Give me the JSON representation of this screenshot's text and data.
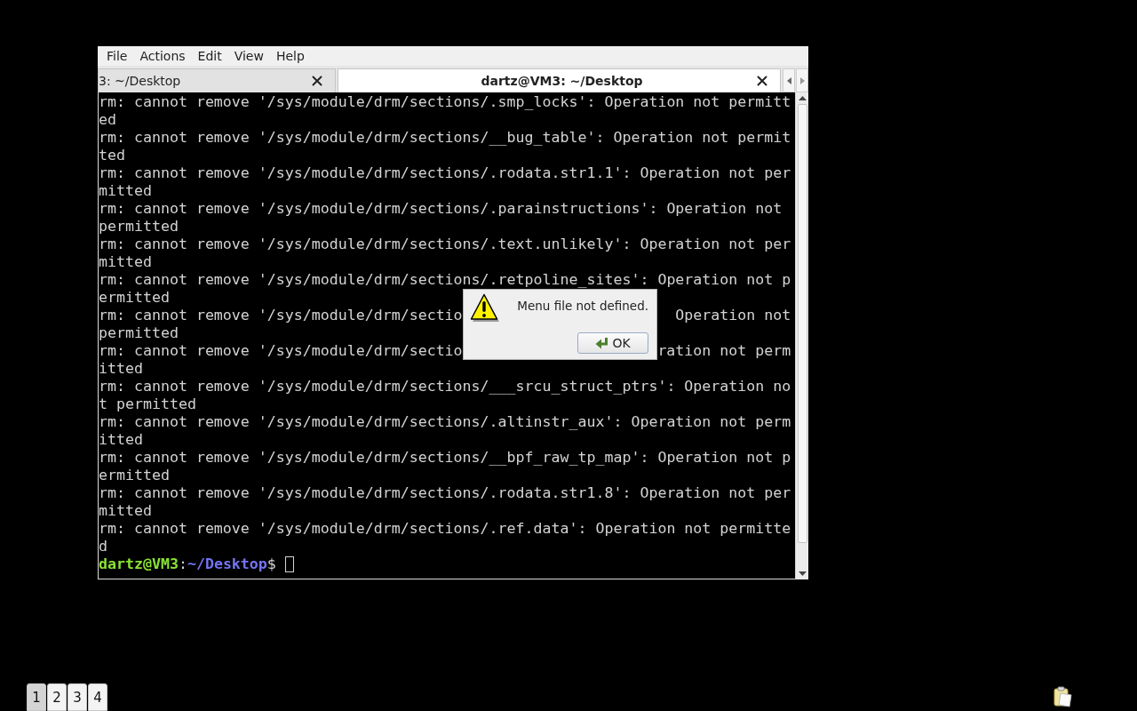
{
  "window": {
    "menu": [
      "File",
      "Actions",
      "Edit",
      "View",
      "Help"
    ],
    "tabs": [
      {
        "label": "3: ~/Desktop",
        "selected": false
      },
      {
        "label": "dartz@VM3: ~/Desktop",
        "selected": true
      }
    ],
    "terminal": {
      "lines": [
        {
          "kind": "output",
          "text": "rm: cannot remove '/sys/module/drm/sections/.smp_locks': Operation not permitt"
        },
        {
          "kind": "output",
          "text": "ed"
        },
        {
          "kind": "output",
          "text": "rm: cannot remove '/sys/module/drm/sections/__bug_table': Operation not permit"
        },
        {
          "kind": "output",
          "text": "ted"
        },
        {
          "kind": "output",
          "text": "rm: cannot remove '/sys/module/drm/sections/.rodata.str1.1': Operation not per"
        },
        {
          "kind": "output",
          "text": "mitted"
        },
        {
          "kind": "output",
          "text": "rm: cannot remove '/sys/module/drm/sections/.parainstructions': Operation not"
        },
        {
          "kind": "output",
          "text": "permitted"
        },
        {
          "kind": "output",
          "text": "rm: cannot remove '/sys/module/drm/sections/.text.unlikely': Operation not per"
        },
        {
          "kind": "output",
          "text": "mitted"
        },
        {
          "kind": "output",
          "text": "rm: cannot remove '/sys/module/drm/sections/.retpoline_sites': Operation not p"
        },
        {
          "kind": "output",
          "text": "ermitted"
        },
        {
          "kind": "covered",
          "left": "rm: cannot remove '/sys/module/drm/sectio",
          "right": "Operation not"
        },
        {
          "kind": "output",
          "text": "permitted"
        },
        {
          "kind": "covered",
          "left": "rm: cannot remove '/sys/module/drm/sectio",
          "right": "ration not perm"
        },
        {
          "kind": "output",
          "text": "itted"
        },
        {
          "kind": "output",
          "text": "rm: cannot remove '/sys/module/drm/sections/___srcu_struct_ptrs': Operation no"
        },
        {
          "kind": "output",
          "text": "t permitted"
        },
        {
          "kind": "output",
          "text": "rm: cannot remove '/sys/module/drm/sections/.altinstr_aux': Operation not perm"
        },
        {
          "kind": "output",
          "text": "itted"
        },
        {
          "kind": "output",
          "text": "rm: cannot remove '/sys/module/drm/sections/__bpf_raw_tp_map': Operation not p"
        },
        {
          "kind": "output",
          "text": "ermitted"
        },
        {
          "kind": "output",
          "text": "rm: cannot remove '/sys/module/drm/sections/.rodata.str1.8': Operation not per"
        },
        {
          "kind": "output",
          "text": "mitted"
        },
        {
          "kind": "output",
          "text": "rm: cannot remove '/sys/module/drm/sections/.ref.data': Operation not permitte"
        },
        {
          "kind": "output",
          "text": "d"
        }
      ],
      "prompt": {
        "user_host": "dartz@VM3",
        "separator": ":",
        "path": "~/Desktop",
        "symbol": "$"
      }
    }
  },
  "dialog": {
    "message": "Menu file not defined.",
    "button": "OK"
  },
  "pager": {
    "workspaces": [
      {
        "label": "1",
        "selected": true
      },
      {
        "label": "2",
        "selected": false
      },
      {
        "label": "3",
        "selected": false
      },
      {
        "label": "4",
        "selected": false
      }
    ]
  }
}
